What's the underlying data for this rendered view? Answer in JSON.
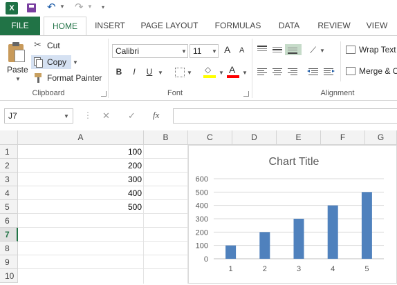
{
  "app": {
    "name": "Excel",
    "logo_letter": "X"
  },
  "qat": {
    "icons": [
      "excel-logo-icon",
      "save-icon",
      "undo-icon",
      "redo-icon",
      "customize-icon"
    ],
    "undo_glyph": "↶",
    "redo_glyph": "↷"
  },
  "tabs": [
    {
      "label": "FILE"
    },
    {
      "label": "HOME"
    },
    {
      "label": "INSERT"
    },
    {
      "label": "PAGE LAYOUT"
    },
    {
      "label": "FORMULAS"
    },
    {
      "label": "DATA"
    },
    {
      "label": "REVIEW"
    },
    {
      "label": "VIEW"
    }
  ],
  "ribbon": {
    "clipboard": {
      "paste": "Paste",
      "cut": "Cut",
      "copy": "Copy",
      "format_painter": "Format Painter",
      "label": "Clipboard"
    },
    "font": {
      "name": "Calibri",
      "size": "11",
      "bold": "B",
      "italic": "I",
      "underline": "U",
      "grow": "A",
      "shrink": "A",
      "label": "Font",
      "highlight_color": "#ffff00",
      "font_color": "#ff0000"
    },
    "alignment": {
      "wrap_text": "Wrap Text",
      "merge": "Merge & C",
      "label": "Alignment"
    }
  },
  "formula_bar": {
    "cell_ref": "J7",
    "fx": "fx",
    "cancel": "✕",
    "enter": "✓",
    "value": ""
  },
  "grid": {
    "columns": [
      "A",
      "B",
      "C",
      "D",
      "E",
      "F",
      "G"
    ],
    "rows": [
      "1",
      "2",
      "3",
      "4",
      "5",
      "6",
      "7",
      "8",
      "9",
      "10"
    ],
    "selected_row": "7",
    "column_a_values": [
      "100",
      "200",
      "300",
      "400",
      "500"
    ]
  },
  "chart_data": {
    "type": "bar",
    "title": "Chart Title",
    "categories": [
      "1",
      "2",
      "3",
      "4",
      "5"
    ],
    "series": [
      {
        "values": [
          100,
          200,
          300,
          400,
          500
        ],
        "color": "#4f81bd"
      }
    ],
    "ylim": [
      0,
      600
    ],
    "yticks": [
      "0",
      "100",
      "200",
      "300",
      "400",
      "500",
      "600"
    ],
    "grid": true,
    "legend": "none"
  }
}
